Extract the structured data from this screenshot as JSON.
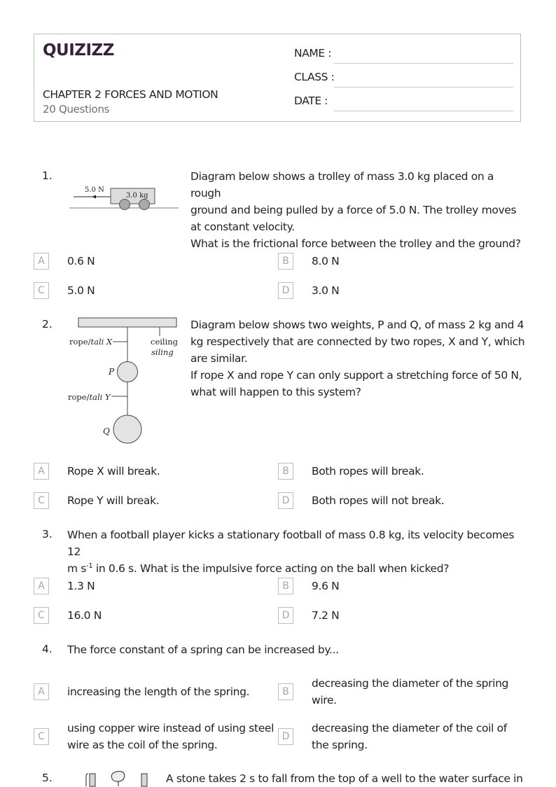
{
  "header": {
    "logo": "QUIZIZZ",
    "title": "CHAPTER 2 FORCES AND MOTION",
    "subtitle": "20 Questions",
    "fields": [
      {
        "label": "NAME :",
        "value": ""
      },
      {
        "label": "CLASS :",
        "value": ""
      },
      {
        "label": "DATE  :",
        "value": ""
      }
    ]
  },
  "questions": [
    {
      "number": "1.",
      "text_lines": [
        "Diagram below shows a trolley of mass 3.0 kg placed on a rough",
        "ground and being pulled by a force of 5.0 N. The trolley moves",
        "at constant velocity.",
        "What is the frictional force between the trolley and the ground?"
      ],
      "diagram": {
        "force_label": "5.0 N",
        "mass_label": "3.0 kg"
      },
      "options": [
        {
          "letter": "A",
          "text": "0.6 N"
        },
        {
          "letter": "B",
          "text": "8.0 N"
        },
        {
          "letter": "C",
          "text": "5.0 N"
        },
        {
          "letter": "D",
          "text": "3.0 N"
        }
      ]
    },
    {
      "number": "2.",
      "text_lines": [
        "Diagram below shows two weights, P and Q, of mass 2 kg and 4",
        "kg respectively that are connected by two ropes, X and Y, which",
        "are similar.",
        "If rope X and rope Y can only support a stretching force of 50 N,",
        "what will happen to this system?"
      ],
      "diagram": {
        "rope_x": "rope/",
        "rope_x_italic": "tali X",
        "rope_y": "rope/",
        "rope_y_italic": "tali Y",
        "ceiling": "ceiling",
        "ceiling_italic": "siling",
        "p": "P",
        "q": "Q"
      },
      "options": [
        {
          "letter": "A",
          "text": "Rope X will break."
        },
        {
          "letter": "B",
          "text": "Both ropes will break."
        },
        {
          "letter": "C",
          "text": "Rope Y will break."
        },
        {
          "letter": "D",
          "text": "Both ropes will not break."
        }
      ]
    },
    {
      "number": "3.",
      "text_line1": "When a football player kicks a stationary football of mass 0.8 kg, its velocity becomes 12",
      "text_line2_pre": "m s",
      "text_line2_sup": "-1",
      "text_line2_post": " in 0.6 s. What is the impulsive force acting on the ball when kicked?",
      "options": [
        {
          "letter": "A",
          "text": "1.3 N"
        },
        {
          "letter": "B",
          "text": "9.6 N"
        },
        {
          "letter": "C",
          "text": "16.0 N"
        },
        {
          "letter": "D",
          "text": "7.2 N"
        }
      ]
    },
    {
      "number": "4.",
      "text": "The force constant of a spring can be increased by...",
      "options": [
        {
          "letter": "A",
          "text": "increasing the length of the spring."
        },
        {
          "letter": "B",
          "text": "decreasing the diameter of the spring wire."
        },
        {
          "letter": "C",
          "text": "using copper wire instead of using steel wire as the coil of the spring."
        },
        {
          "letter": "D",
          "text": "decreasing the diameter of the coil of the spring."
        }
      ]
    },
    {
      "number": "5.",
      "text": "A stone takes 2 s to fall from the top of a well to the water surface in"
    }
  ]
}
